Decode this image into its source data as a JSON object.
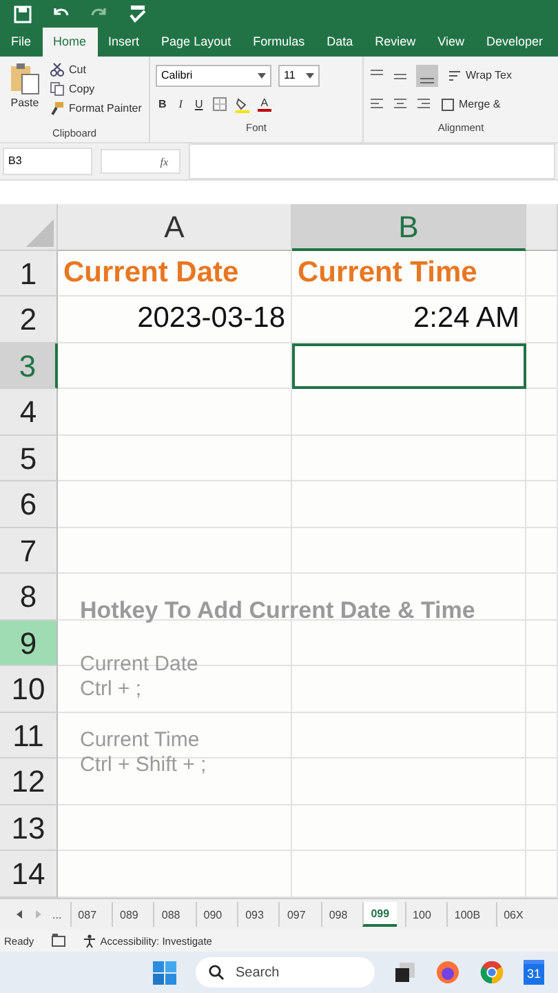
{
  "ribbon_tabs": [
    {
      "label": "File",
      "selected": false
    },
    {
      "label": "Home",
      "selected": true
    },
    {
      "label": "Insert",
      "selected": false
    },
    {
      "label": "Page Layout",
      "selected": false
    },
    {
      "label": "Formulas",
      "selected": false
    },
    {
      "label": "Data",
      "selected": false
    },
    {
      "label": "Review",
      "selected": false
    },
    {
      "label": "View",
      "selected": false
    },
    {
      "label": "Developer",
      "selected": false
    }
  ],
  "clipboard": {
    "paste": "Paste",
    "cut": "Cut",
    "copy": "Copy",
    "format_painter": "Format Painter",
    "group": "Clipboard"
  },
  "font": {
    "name": "Calibri",
    "size": "11",
    "bold": "B",
    "italic": "I",
    "underline": "U",
    "color_letter": "A",
    "group": "Font"
  },
  "alignment": {
    "wrap": "Wrap Tex",
    "merge": "Merge &",
    "group": "Alignment"
  },
  "formula_bar": {
    "name_box": "B3",
    "function_label": "fx"
  },
  "columns": [
    {
      "label": "A",
      "selected": false
    },
    {
      "label": "B",
      "selected": true
    }
  ],
  "rows": [
    {
      "label": "1",
      "selected": false,
      "highlighted": false,
      "kind": "header",
      "cells": [
        "Current Date",
        "Current Time"
      ]
    },
    {
      "label": "2",
      "selected": false,
      "highlighted": false,
      "kind": "data",
      "cells": [
        "2023-03-18",
        "2:24 AM"
      ]
    },
    {
      "label": "3",
      "selected": true,
      "highlighted": false
    },
    {
      "label": "4",
      "selected": false,
      "highlighted": false
    },
    {
      "label": "5",
      "selected": false,
      "highlighted": false
    },
    {
      "label": "6",
      "selected": false,
      "highlighted": false
    },
    {
      "label": "7",
      "selected": false,
      "highlighted": false
    },
    {
      "label": "8",
      "selected": false,
      "highlighted": false
    },
    {
      "label": "9",
      "selected": false,
      "highlighted": true
    },
    {
      "label": "10",
      "selected": false,
      "highlighted": false
    },
    {
      "label": "11",
      "selected": false,
      "highlighted": false
    },
    {
      "label": "12",
      "selected": false,
      "highlighted": false
    },
    {
      "label": "13",
      "selected": false,
      "highlighted": false
    },
    {
      "label": "14",
      "selected": false,
      "highlighted": false
    }
  ],
  "overlay": {
    "title": "Hotkey To Add Current Date & Time",
    "lines": [
      "Current Date",
      "Ctrl + ;",
      "Current Time",
      "Ctrl + Shift + ;"
    ]
  },
  "sheet_tabs": {
    "more": "...",
    "tabs": [
      {
        "label": "087",
        "selected": false
      },
      {
        "label": "089",
        "selected": false
      },
      {
        "label": "088",
        "selected": false
      },
      {
        "label": "090",
        "selected": false
      },
      {
        "label": "093",
        "selected": false
      },
      {
        "label": "097",
        "selected": false
      },
      {
        "label": "098",
        "selected": false
      },
      {
        "label": "099",
        "selected": true
      },
      {
        "label": "100",
        "selected": false
      },
      {
        "label": "100B",
        "selected": false
      },
      {
        "label": "06X",
        "selected": false
      }
    ]
  },
  "status_bar": {
    "ready": "Ready",
    "accessibility": "Accessibility: Investigate"
  },
  "taskbar": {
    "search_placeholder": "Search",
    "calendar_day": "31"
  }
}
